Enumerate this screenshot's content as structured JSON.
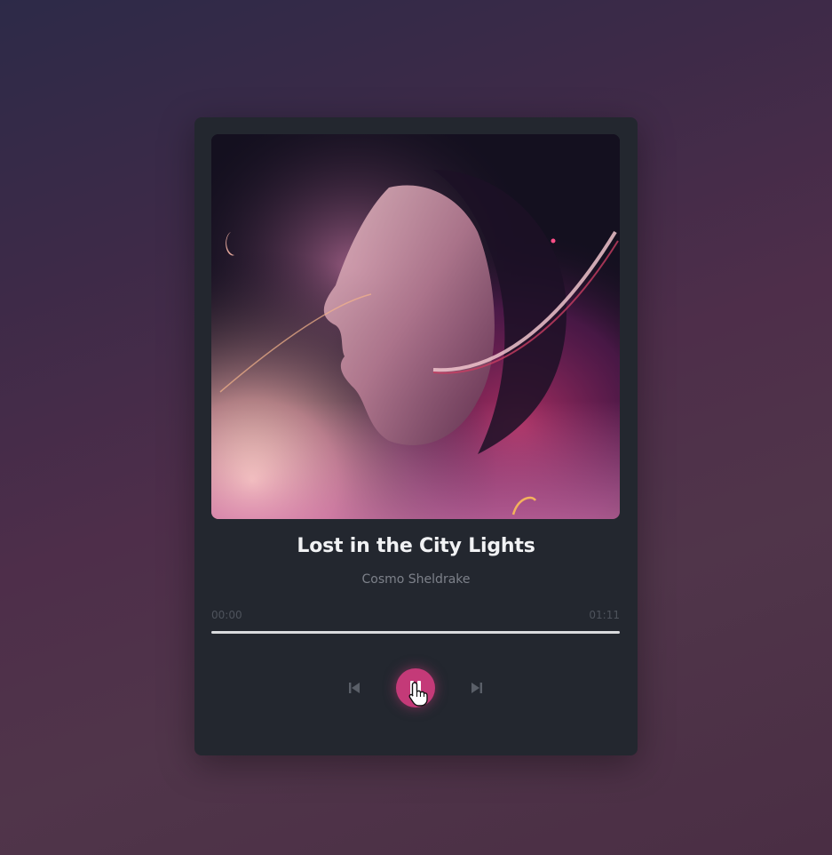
{
  "track": {
    "title": "Lost in the City Lights",
    "artist": "Cosmo Sheldrake"
  },
  "progress": {
    "current_time": "00:00",
    "duration": "01:11",
    "fraction": 1.0
  },
  "controls": {
    "previous_icon": "skip-previous-icon",
    "play_state": "pause-icon",
    "next_icon": "skip-next-icon"
  },
  "colors": {
    "accent": "#c43a78",
    "card_background": "#23272f",
    "title": "#f1f2f4",
    "artist": "#7d818a"
  }
}
